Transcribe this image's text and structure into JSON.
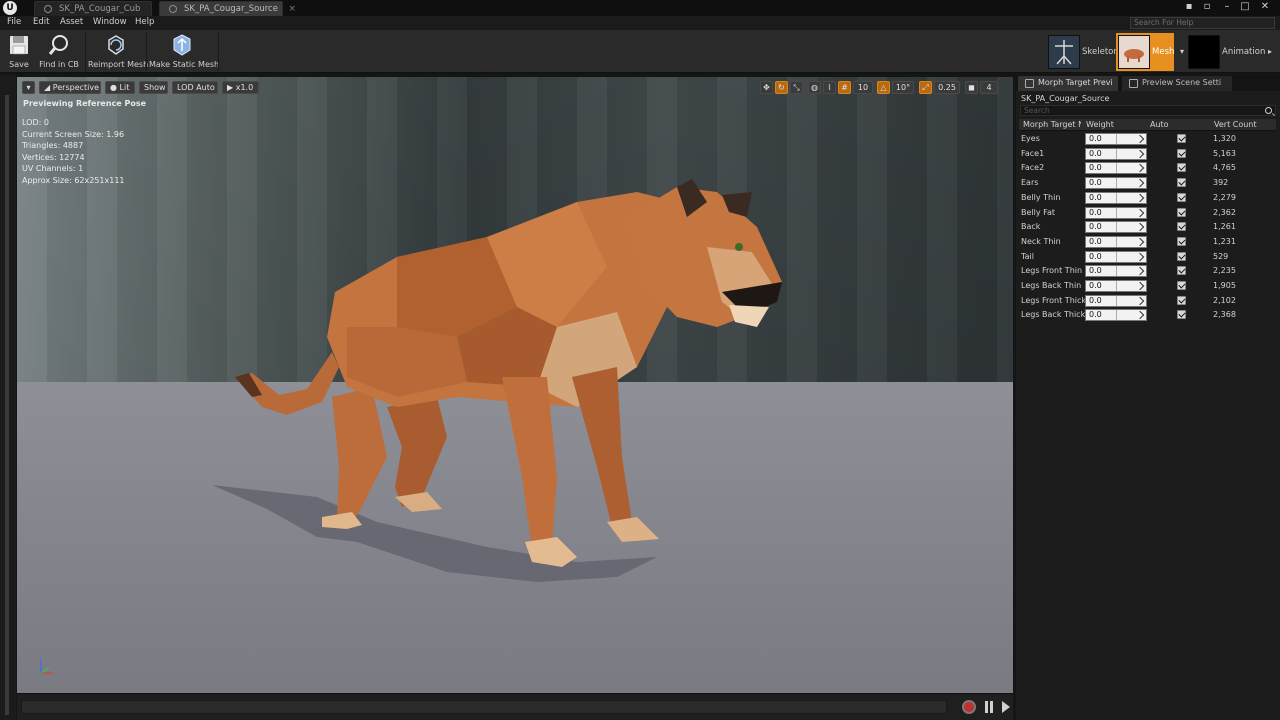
{
  "tabs": [
    {
      "label": "SK_PA_Cougar_Cub",
      "active": false
    },
    {
      "label": "SK_PA_Cougar_Source",
      "active": true
    }
  ],
  "search_help": {
    "placeholder": "Search For Help"
  },
  "menu": [
    "File",
    "Edit",
    "Asset",
    "Window",
    "Help"
  ],
  "toolbar": {
    "save": "Save",
    "find_in_cb": "Find in CB",
    "reimport_mesh": "Reimport Mesh",
    "make_static_mesh": "Make Static Mesh"
  },
  "modes": {
    "skeleton": "Skeleton",
    "mesh": "Mesh",
    "animation": "Animation"
  },
  "viewport": {
    "perspective": "Perspective",
    "lit": "Lit",
    "show": "Show",
    "lod": "LOD Auto",
    "speed": "x1.0",
    "grid_snap": "10",
    "rot_snap": "10°",
    "scale_snap": "0.25",
    "camera_speed": "4",
    "preview_text": "Previewing Reference Pose",
    "stats": [
      "LOD: 0",
      "Current Screen Size: 1.96",
      "Triangles: 4887",
      "Vertices: 12774",
      "UV Channels: 1",
      "Approx Size: 62x251x111"
    ]
  },
  "panel": {
    "tabs": [
      "Morph Target Previ",
      "Preview Scene Setti"
    ],
    "asset_name": "SK_PA_Cougar_Source",
    "search_placeholder": "Search",
    "columns": {
      "name": "Morph Target Na",
      "weight": "Weight",
      "auto": "Auto",
      "vert_count": "Vert Count"
    },
    "rows": [
      {
        "name": "Eyes",
        "weight": "0.0",
        "vert_count": "1,320"
      },
      {
        "name": "Face1",
        "weight": "0.0",
        "vert_count": "5,163"
      },
      {
        "name": "Face2",
        "weight": "0.0",
        "vert_count": "4,765"
      },
      {
        "name": "Ears",
        "weight": "0.0",
        "vert_count": "392"
      },
      {
        "name": "Belly Thin",
        "weight": "0.0",
        "vert_count": "2,279"
      },
      {
        "name": "Belly Fat",
        "weight": "0.0",
        "vert_count": "2,362"
      },
      {
        "name": "Back",
        "weight": "0.0",
        "vert_count": "1,261"
      },
      {
        "name": "Neck Thin",
        "weight": "0.0",
        "vert_count": "1,231"
      },
      {
        "name": "Tail",
        "weight": "0.0",
        "vert_count": "529"
      },
      {
        "name": "Legs Front Thin",
        "weight": "0.0",
        "vert_count": "2,235"
      },
      {
        "name": "Legs Back Thin",
        "weight": "0.0",
        "vert_count": "1,905"
      },
      {
        "name": "Legs Front Thick",
        "weight": "0.0",
        "vert_count": "2,102"
      },
      {
        "name": "Legs Back Thick",
        "weight": "0.0",
        "vert_count": "2,368"
      }
    ]
  },
  "colors": {
    "accent": "#e8901f",
    "record": "#c03030"
  }
}
